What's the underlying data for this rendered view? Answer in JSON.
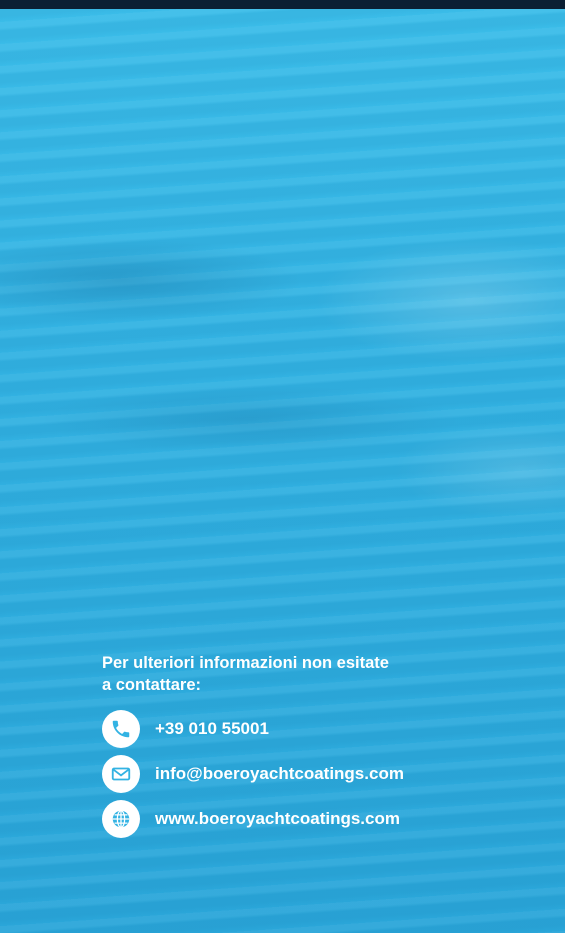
{
  "colors": {
    "sea": "#33b3e3",
    "top_bar": "#0b1f33",
    "text": "#ffffff",
    "icon_bg": "#ffffff"
  },
  "contact": {
    "intro_line1": "Per ulteriori informazioni non esitate",
    "intro_line2": "a contattare:",
    "items": [
      {
        "icon": "phone-icon",
        "text": "+39 010 55001"
      },
      {
        "icon": "email-icon",
        "text": "info@boeroyachtcoatings.com"
      },
      {
        "icon": "globe-icon",
        "text": "www.boeroyachtcoatings.com"
      }
    ]
  }
}
